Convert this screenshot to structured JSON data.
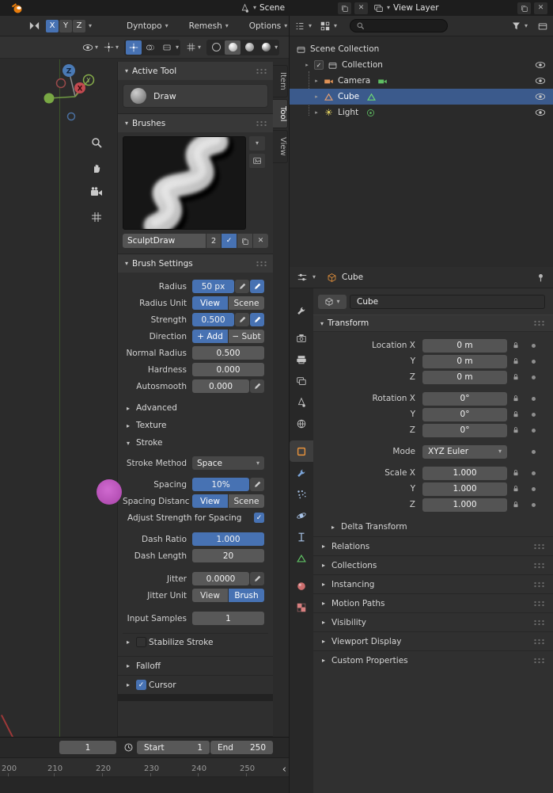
{
  "topbar": {
    "scene_label": "Scene",
    "view_layer_label": "View Layer"
  },
  "tool_settings": {
    "sym_x": "X",
    "sym_y": "Y",
    "sym_z": "Z",
    "menu_dyntopo": "Dyntopo",
    "menu_remesh": "Remesh",
    "menu_options": "Options"
  },
  "nav_tabs": {
    "item": "Item",
    "tool": "Tool",
    "view": "View"
  },
  "outliner": {
    "scene_collection": "Scene Collection",
    "collection": "Collection",
    "camera": "Camera",
    "cube": "Cube",
    "light": "Light"
  },
  "active_tool_panel": {
    "title": "Active Tool",
    "tool_name": "Draw"
  },
  "brushes_panel": {
    "title": "Brushes",
    "brush_name": "SculptDraw",
    "user_count": "2"
  },
  "brush_settings": {
    "title": "Brush Settings",
    "radius_label": "Radius",
    "radius_value": "50 px",
    "radius_unit_label": "Radius Unit",
    "view": "View",
    "scene": "Scene",
    "strength_label": "Strength",
    "strength_value": "0.500",
    "direction_label": "Direction",
    "add": "+ Add",
    "subtract": "− Subt",
    "normal_radius_label": "Normal Radius",
    "normal_radius_value": "0.500",
    "hardness_label": "Hardness",
    "hardness_value": "0.000",
    "autosmooth_label": "Autosmooth",
    "autosmooth_value": "0.000",
    "advanced": "Advanced",
    "texture": "Texture",
    "stroke": "Stroke",
    "stroke_method_label": "Stroke Method",
    "stroke_method_value": "Space",
    "spacing_label": "Spacing",
    "spacing_value": "10%",
    "spacing_distance_label": "Spacing Distanc",
    "spacing_view": "View",
    "spacing_scene": "Scene",
    "adjust_strength_label": "Adjust Strength for Spacing",
    "dash_ratio_label": "Dash Ratio",
    "dash_ratio_value": "1.000",
    "dash_length_label": "Dash Length",
    "dash_length_value": "20",
    "jitter_label": "Jitter",
    "jitter_value": "0.0000",
    "jitter_unit_label": "Jitter Unit",
    "jitter_view": "View",
    "jitter_brush": "Brush",
    "input_samples_label": "Input Samples",
    "input_samples_value": "1",
    "stabilize_stroke": "Stabilize Stroke",
    "falloff": "Falloff",
    "cursor": "Cursor"
  },
  "properties": {
    "breadcrumb": "Cube",
    "object_name": "Cube",
    "transform_title": "Transform",
    "rows": [
      {
        "label": "Location X",
        "value": "0 m"
      },
      {
        "label": "Y",
        "value": "0 m"
      },
      {
        "label": "Z",
        "value": "0 m"
      },
      {
        "label": "Rotation X",
        "value": "0°"
      },
      {
        "label": "Y",
        "value": "0°"
      },
      {
        "label": "Z",
        "value": "0°"
      },
      {
        "label": "Mode",
        "value": "XYZ Euler"
      },
      {
        "label": "Scale X",
        "value": "1.000"
      },
      {
        "label": "Y",
        "value": "1.000"
      },
      {
        "label": "Z",
        "value": "1.000"
      }
    ],
    "delta_transform": "Delta Transform",
    "sections": [
      "Relations",
      "Collections",
      "Instancing",
      "Motion Paths",
      "Visibility",
      "Viewport Display",
      "Custom Properties"
    ]
  },
  "timeline": {
    "current_frame": "1",
    "start_label": "Start",
    "start_value": "1",
    "end_label": "End",
    "end_value": "250",
    "ruler": [
      "200",
      "210",
      "220",
      "230",
      "240",
      "250"
    ]
  },
  "colors": {
    "accent_blue": "#4772b3",
    "selection": "#3b5a8c",
    "object_orange": "#e8933c",
    "data_green": "#5fbf63"
  }
}
